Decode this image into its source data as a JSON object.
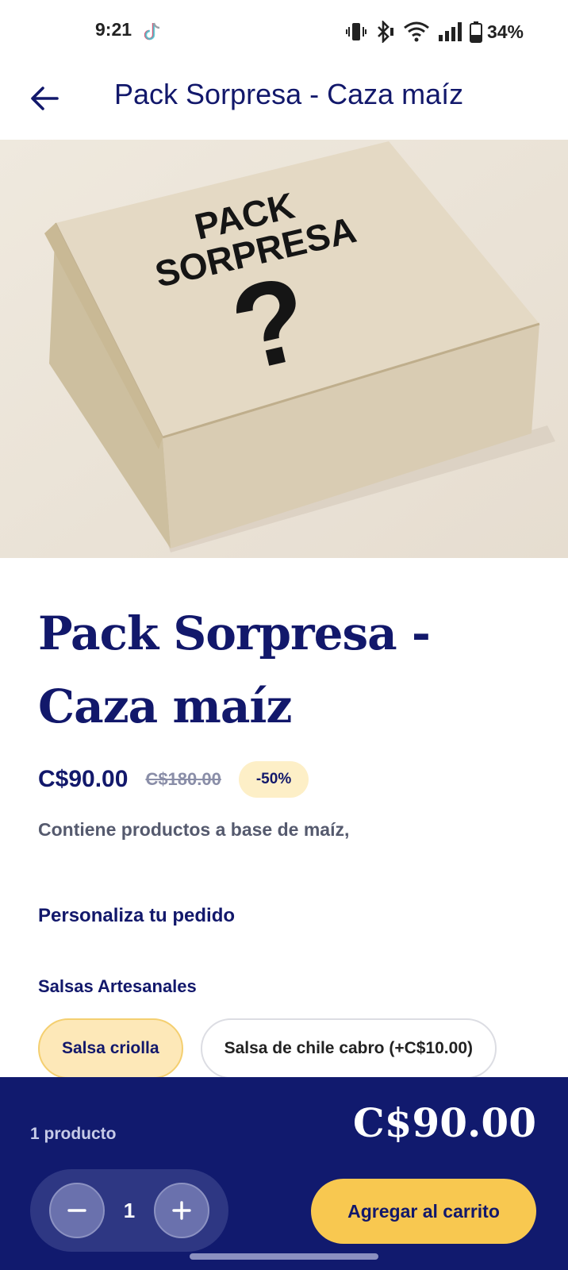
{
  "status_bar": {
    "time": "9:21",
    "battery": "34%",
    "icons": [
      "tiktok-icon",
      "vibrate-icon",
      "bluetooth-icon",
      "wifi-icon",
      "signal-icon",
      "battery-icon"
    ]
  },
  "app_bar": {
    "back_icon": "arrow-left-icon",
    "title": "Pack Sorpresa - Caza maíz"
  },
  "hero": {
    "box_text_line1": "PACK",
    "box_text_line2": "SORPRESA",
    "box_symbol": "?"
  },
  "product": {
    "title": "Pack Sorpresa - Caza maíz",
    "price": "C$90.00",
    "old_price": "C$180.00",
    "discount": "-50%",
    "description": "Contiene productos a base de maíz,"
  },
  "customize": {
    "heading": "Personaliza tu pedido",
    "group_heading": "Salsas Artesanales",
    "options": [
      {
        "label": "Salsa criolla",
        "selected": true
      },
      {
        "label": "Salsa de chile cabro (+C$10.00)",
        "selected": false
      }
    ]
  },
  "bottom_bar": {
    "item_count": "1 producto",
    "total": "C$90.00",
    "quantity": "1",
    "add_button": "Agregar al carrito"
  },
  "colors": {
    "brand_navy": "#12186b",
    "bottom_bar": "#111a6e",
    "accent_yellow": "#f8c850",
    "badge_bg": "#fdefc7"
  }
}
